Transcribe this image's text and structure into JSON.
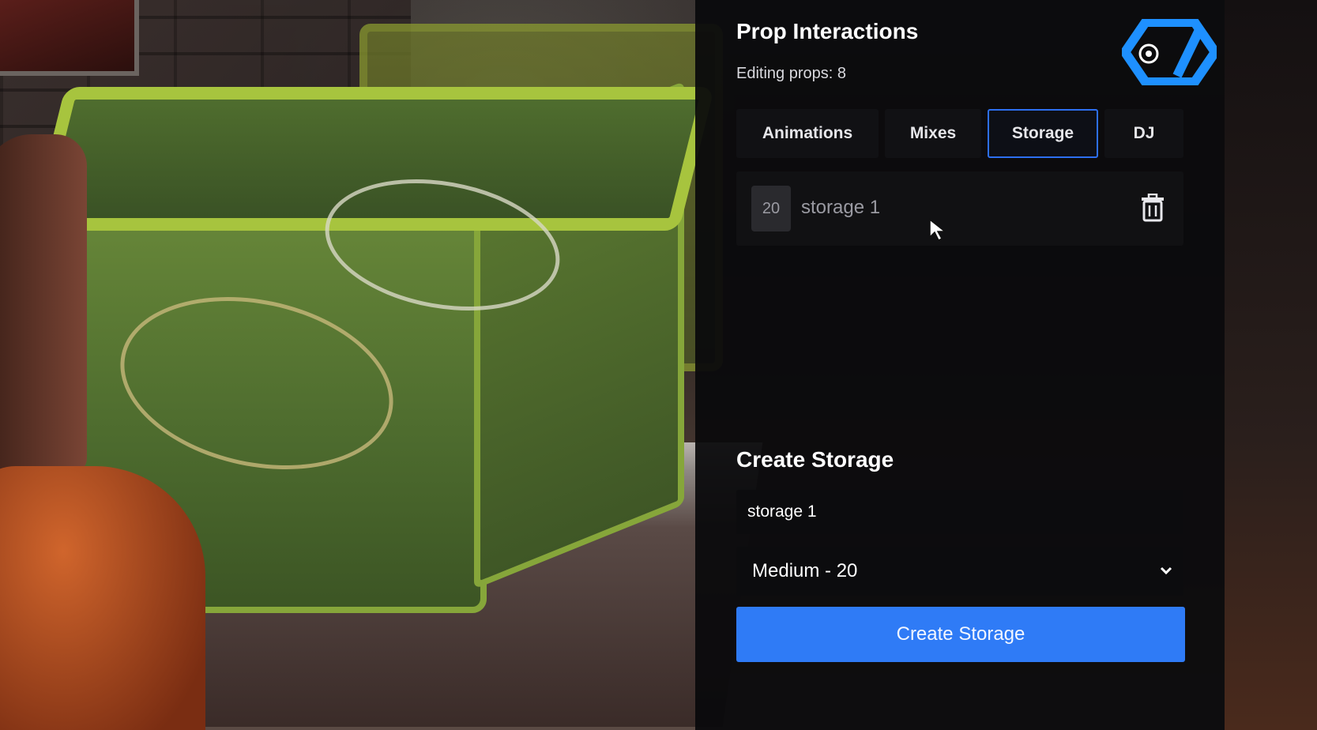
{
  "panel": {
    "title": "Prop Interactions",
    "subtitle": "Editing props: 8",
    "logo_icon": "brand-logo-icon",
    "accent_color": "#2f7bf6"
  },
  "tabs": [
    {
      "label": "Animations",
      "active": false
    },
    {
      "label": "Mixes",
      "active": false
    },
    {
      "label": "Storage",
      "active": true
    },
    {
      "label": "DJ",
      "active": false
    }
  ],
  "storage_list": [
    {
      "capacity": "20",
      "name": "storage 1",
      "delete_icon": "trash-icon"
    }
  ],
  "create": {
    "heading": "Create Storage",
    "name_value": "storage 1",
    "size_selected": "Medium - 20",
    "submit_label": "Create Storage"
  }
}
